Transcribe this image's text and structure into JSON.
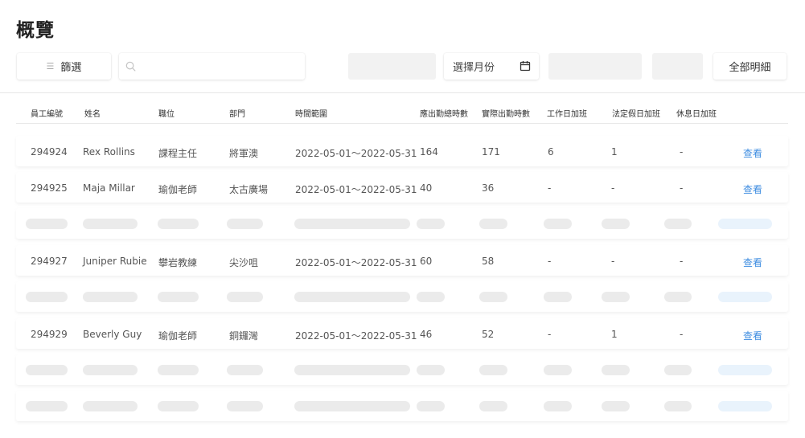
{
  "header": {
    "title": "概覽"
  },
  "toolbar": {
    "filter_label": "篩選",
    "search_placeholder": "",
    "month_placeholder": "選擇月份",
    "detail_label": "全部明細"
  },
  "table": {
    "columns": [
      "員工編號",
      "姓名",
      "職位",
      "部門",
      "時間範圍",
      "應出勤總時數",
      "實際出勤時數",
      "工作日加班",
      "法定假日加班",
      "休息日加班"
    ],
    "view_label": "查看",
    "rows": [
      {
        "id": "294924",
        "name": "Rex Rollins",
        "position": "課程主任",
        "dept": "將軍澳",
        "range": "2022-05-01～2022-05-31",
        "expected": "164",
        "actual": "171",
        "weekday_ot": "6",
        "holiday_ot": "1",
        "rest_ot": "-"
      },
      {
        "id": "294925",
        "name": "Maja Millar",
        "position": "瑜伽老師",
        "dept": "太古廣場",
        "range": "2022-05-01～2022-05-31",
        "expected": "40",
        "actual": "36",
        "weekday_ot": "-",
        "holiday_ot": "-",
        "rest_ot": "-"
      },
      {
        "id": "294927",
        "name": "Juniper Rubie",
        "position": "攀岩教練",
        "dept": "尖沙咀",
        "range": "2022-05-01～2022-05-31",
        "expected": "60",
        "actual": "58",
        "weekday_ot": "-",
        "holiday_ot": "-",
        "rest_ot": "-"
      },
      {
        "id": "294929",
        "name": "Beverly Guy",
        "position": "瑜伽老師",
        "dept": "銅鑼灣",
        "range": "2022-05-01～2022-05-31",
        "expected": "46",
        "actual": "52",
        "weekday_ot": "-",
        "holiday_ot": "1",
        "rest_ot": "-"
      }
    ]
  }
}
